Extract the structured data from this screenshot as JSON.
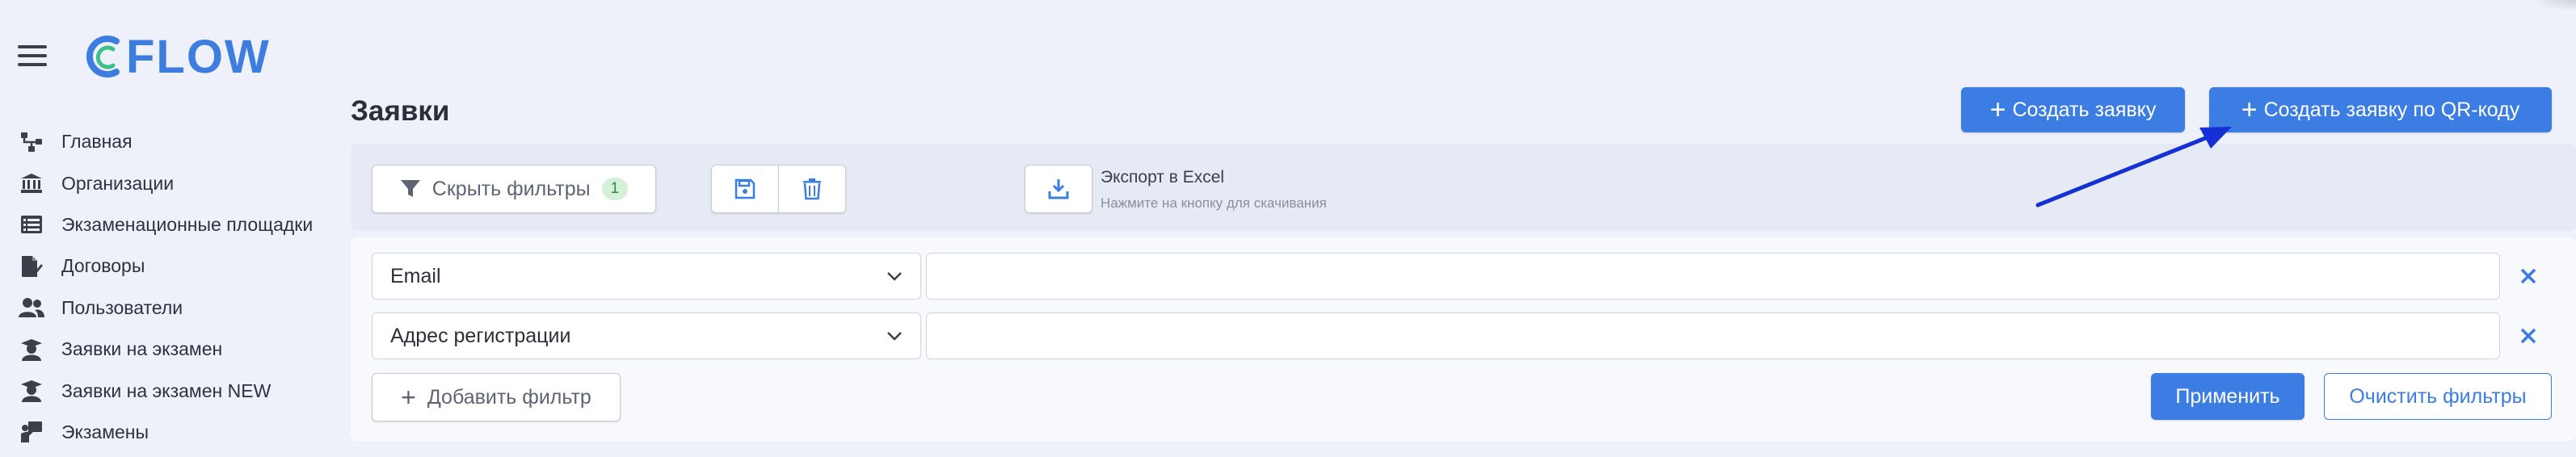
{
  "brand": {
    "name": "FLOW"
  },
  "sidebar": {
    "items": [
      {
        "label": "Главная",
        "icon": "sitemap-icon"
      },
      {
        "label": "Организации",
        "icon": "bank-icon"
      },
      {
        "label": "Экзаменационные площадки",
        "icon": "list-icon"
      },
      {
        "label": "Договоры",
        "icon": "file-signature-icon"
      },
      {
        "label": "Пользователи",
        "icon": "users-icon"
      },
      {
        "label": "Заявки на экзамен",
        "icon": "graduate-icon"
      },
      {
        "label": "Заявки на экзамен NEW",
        "icon": "graduate-icon"
      },
      {
        "label": "Экзамены",
        "icon": "teacher-board-icon"
      }
    ]
  },
  "page": {
    "title": "Заявки"
  },
  "actions": {
    "create_label": "Создать заявку",
    "create_qr_label": "Создать заявку по QR-коду"
  },
  "toolbar": {
    "hide_filters_label": "Скрыть фильтры",
    "filter_count": "1",
    "export_title": "Экспорт в Excel",
    "export_hint": "Нажмите на кнопку для скачивания"
  },
  "filters": [
    {
      "field": "Email",
      "value": ""
    },
    {
      "field": "Адрес регистрации",
      "value": ""
    }
  ],
  "filter_actions": {
    "add_label": "Добавить фильтр",
    "apply_label": "Применить",
    "clear_label": "Очистить фильтры"
  },
  "colors": {
    "accent": "#3b7de3",
    "background": "#eef1f9",
    "badge_bg": "#d6f1da",
    "arrow": "#1531d6"
  }
}
